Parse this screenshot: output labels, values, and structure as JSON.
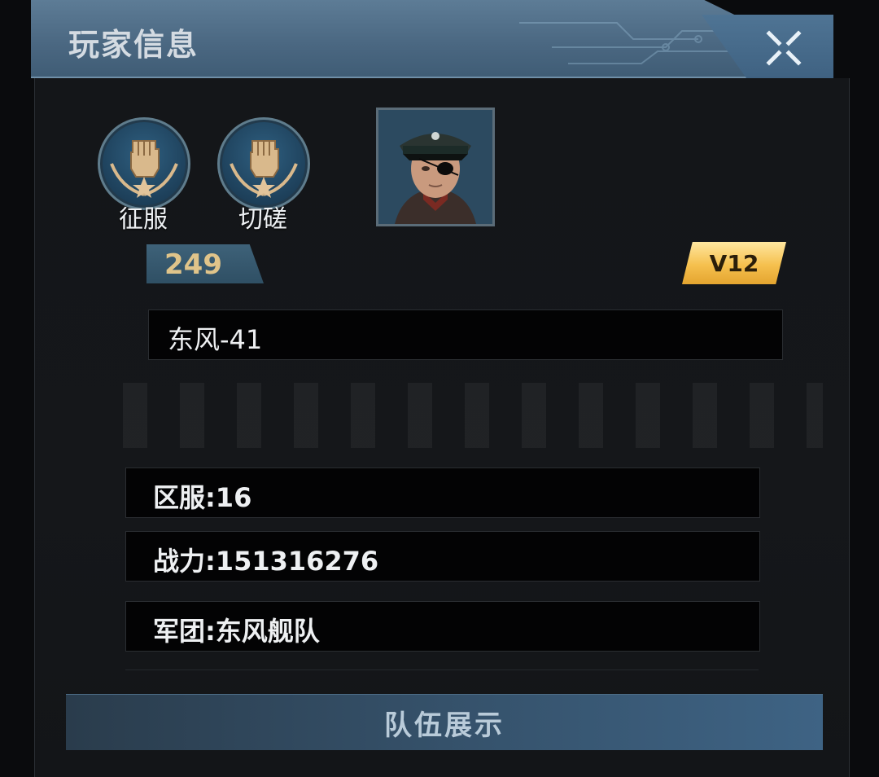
{
  "window": {
    "title": "玩家信息",
    "close_icon": "close-icon"
  },
  "actions": [
    {
      "label": "征服",
      "icon": "fist-emblem-icon"
    },
    {
      "label": "切磋",
      "icon": "fist-emblem-icon"
    }
  ],
  "player": {
    "level": "249",
    "vip": "V12",
    "name": "东风-41",
    "server": "区服:16",
    "power": "战力:151316276",
    "legion": "军团:东风舰队"
  },
  "footer": {
    "team_button": "队伍展示"
  },
  "colors": {
    "header_blue": "#4b6882",
    "gold_text": "#e0c48a",
    "vip_gold": "#f5c04e",
    "panel_bg": "#141619"
  }
}
